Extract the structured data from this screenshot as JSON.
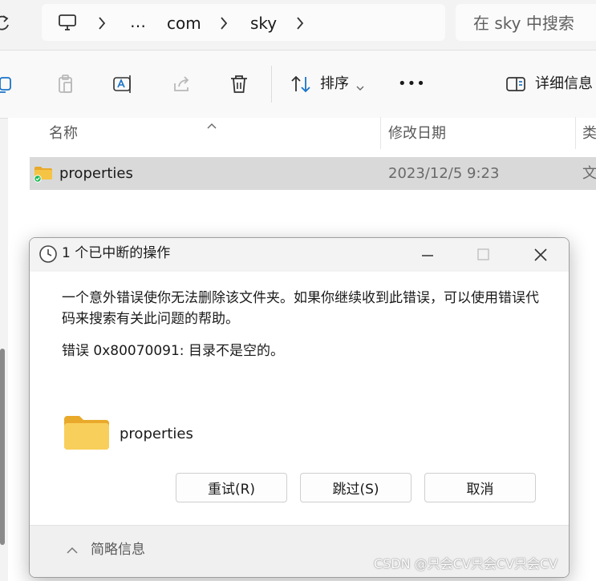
{
  "address_bar": {
    "crumbs": [
      "…",
      "com",
      "sky"
    ],
    "search_placeholder": "在 sky 中搜索"
  },
  "toolbar": {
    "sort_label": "排序",
    "more_label": "•••",
    "details_label": "详细信息"
  },
  "file_list": {
    "columns": [
      "名称",
      "修改日期",
      "类"
    ],
    "rows": [
      {
        "name": "properties",
        "modified": "2023/12/5 9:23",
        "type": "文"
      }
    ]
  },
  "dialog": {
    "title": "1 个已中断的操作",
    "message": "一个意外错误使你无法删除该文件夹。如果你继续收到此错误，可以使用错误代码来搜索有关此问题的帮助。",
    "error_line": "错误 0x80070091: 目录不是空的。",
    "item_name": "properties",
    "buttons": {
      "retry": "重试(R)",
      "skip": "跳过(S)",
      "cancel": "取消"
    },
    "footer_label": "简略信息"
  },
  "watermark": "CSDN @只会CV只会CV只会CV",
  "colors": {
    "folder": "#f6c444",
    "folder_dark": "#e9a92b",
    "status_green": "#1db954",
    "selection": "#d9d9d9"
  }
}
